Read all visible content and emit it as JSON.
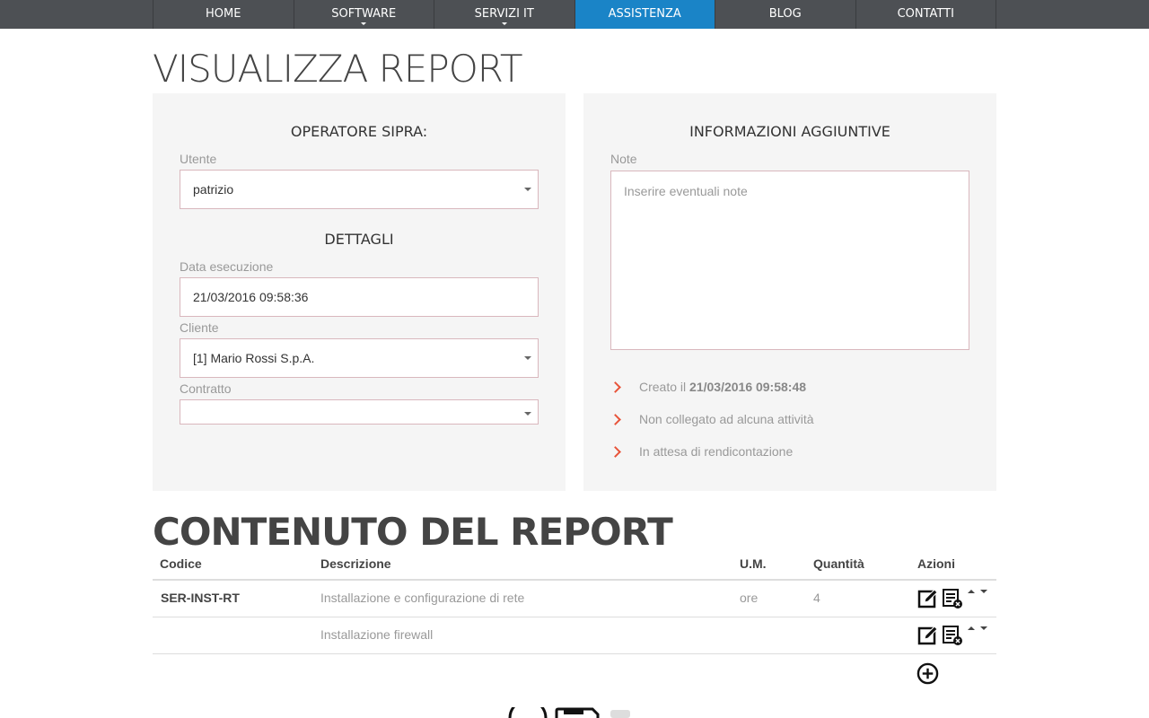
{
  "nav": {
    "items": [
      {
        "label": "HOME"
      },
      {
        "label": "SOFTWARE"
      },
      {
        "label": "SERVIZI IT"
      },
      {
        "label": "ASSISTENZA"
      },
      {
        "label": "BLOG"
      },
      {
        "label": "CONTATTI"
      }
    ],
    "active_color": "#1a84c7"
  },
  "page_title": "VISUALIZZA REPORT",
  "operatore": {
    "heading": "OPERATORE SIPRA:",
    "utente_label": "Utente",
    "utente_value": "patrizio"
  },
  "dettagli": {
    "heading": "DETTAGLI",
    "data_label": "Data esecuzione",
    "data_value": "21/03/2016 09:58:36",
    "cliente_label": "Cliente",
    "cliente_value": "[1] Mario Rossi S.p.A.",
    "contratto_label": "Contratto",
    "contratto_value": ""
  },
  "info": {
    "heading": "INFORMAZIONI AGGIUNTIVE",
    "note_label": "Note",
    "note_placeholder": "Inserire eventuali note",
    "created_prefix": "Creato il ",
    "created_value": "21/03/2016 09:58:48",
    "status_activity": "Non collegato ad alcuna attività",
    "status_billing": "In attesa di rendicontazione",
    "accent_color": "#e8543a"
  },
  "content": {
    "title": "CONTENUTO DEL REPORT",
    "headers": {
      "codice": "Codice",
      "descrizione": "Descrizione",
      "um": "U.M.",
      "quantita": "Quantità",
      "azioni": "Azioni"
    },
    "rows": [
      {
        "codice": "SER-INST-RT",
        "descrizione": "Installazione e configurazione di rete",
        "um": "ore",
        "quantita": "4"
      },
      {
        "codice": "",
        "descrizione": "Installazione firewall",
        "um": "",
        "quantita": ""
      }
    ]
  }
}
